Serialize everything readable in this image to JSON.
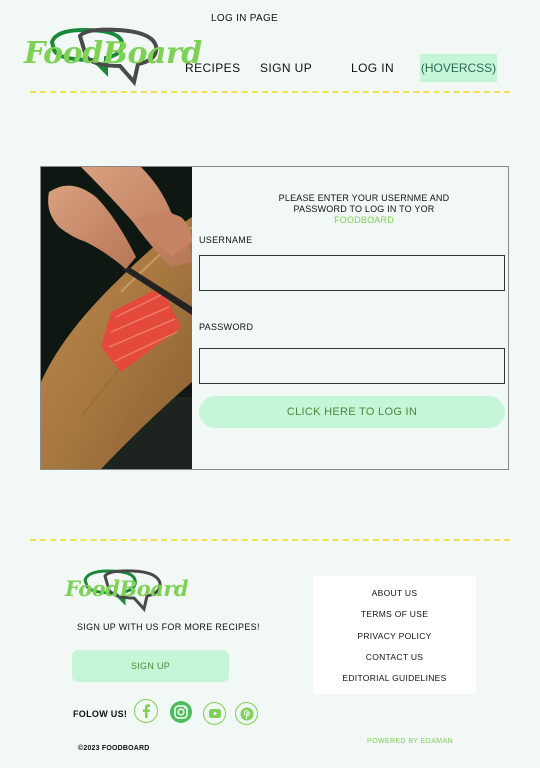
{
  "page": {
    "label": "LOG IN PAGE"
  },
  "header": {
    "logo_text": "FoodBoard",
    "nav": {
      "recipes": "RECIPES",
      "signup": "SIGN UP",
      "login": "LOG IN"
    },
    "hover_button": "(HOVERCSS)"
  },
  "login_card": {
    "intro_line1": "PLEASE  ENTER YOUR USERNME AND",
    "intro_line2": "PASSWORD TO LOG IN  TO YOR",
    "intro_brand": "FOODBOARD",
    "username_label": "USERNAME",
    "username_value": "",
    "password_label": "PASSWORD",
    "password_value": "",
    "submit_label": "CLICK HERE TO LOG IN"
  },
  "footer": {
    "logo_text": "FoodBoard",
    "tagline": "SIGN UP WITH US  FOR  MORE RECIPES!",
    "signup_label": "SIGN UP",
    "follow_label": "FOLOW US!",
    "social_icons": [
      "facebook-icon",
      "instagram-icon",
      "youtube-icon",
      "pinterest-icon"
    ],
    "copyright": "©2023 FOODBOARD",
    "links": [
      "ABOUT US",
      "TERMS OF USE",
      "PRIVACY POLICY",
      "CONTACT US",
      "EDITORIAL GUIDELINES"
    ],
    "powered_by": "POWERED BY  EDAMAN"
  },
  "colors": {
    "background": "#f1f8f6",
    "accent_green": "#7dd155",
    "button_mint": "#c6f6d8",
    "dash_yellow": "#f0e24a",
    "logo_dark": "#1a8a3a",
    "logo_grey": "#4a4a4a"
  }
}
